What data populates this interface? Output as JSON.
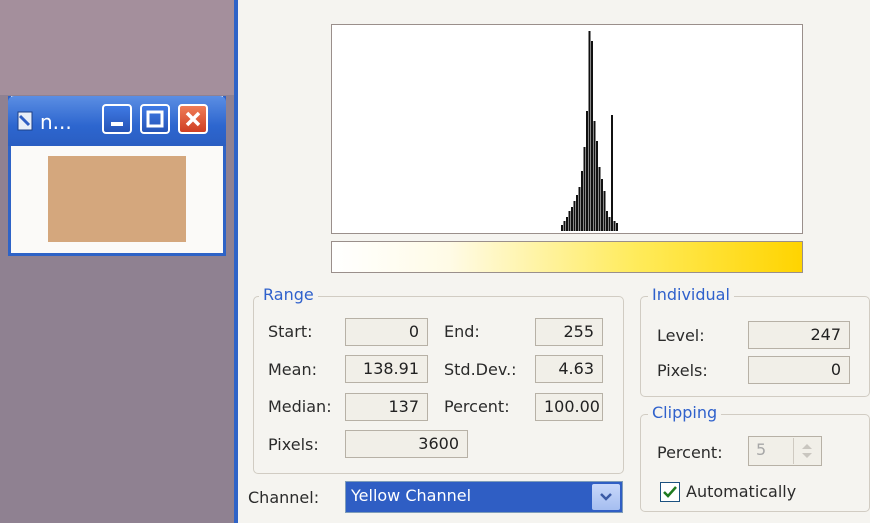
{
  "mini_window": {
    "title": "n...",
    "icons": [
      "document-icon",
      "minimize-icon",
      "maximize-icon",
      "close-icon"
    ],
    "preview_color": "#d4a77d"
  },
  "histogram": {
    "bars": [
      {
        "value": 10,
        "strength": 0.03
      },
      {
        "value": 11,
        "strength": 0.05
      },
      {
        "value": 12,
        "strength": 0.07
      },
      {
        "value": 13,
        "strength": 0.1
      },
      {
        "value": 14,
        "strength": 0.12
      },
      {
        "value": 15,
        "strength": 0.15
      },
      {
        "value": 16,
        "strength": 0.18
      },
      {
        "value": 17,
        "strength": 0.22
      },
      {
        "value": 18,
        "strength": 0.3
      },
      {
        "value": 19,
        "strength": 0.42
      },
      {
        "value": 20,
        "strength": 0.6
      },
      {
        "value": 21,
        "strength": 1.0
      },
      {
        "value": 22,
        "strength": 0.95
      },
      {
        "value": 23,
        "strength": 0.55
      },
      {
        "value": 24,
        "strength": 0.45
      },
      {
        "value": 25,
        "strength": 0.32
      },
      {
        "value": 26,
        "strength": 0.26
      },
      {
        "value": 27,
        "strength": 0.2
      },
      {
        "value": 28,
        "strength": 0.1
      },
      {
        "value": 29,
        "strength": 0.07
      },
      {
        "value": 30,
        "strength": 0.58
      },
      {
        "value": 31,
        "strength": 0.05
      },
      {
        "value": 32,
        "strength": 0.04
      }
    ],
    "gradient_colors": [
      "#ffffff",
      "#ffd400"
    ]
  },
  "range": {
    "title": "Range",
    "start_label": "Start:",
    "start": "0",
    "end_label": "End:",
    "end": "255",
    "mean_label": "Mean:",
    "mean": "138.91",
    "stddev_label": "Std.Dev.:",
    "stddev": "4.63",
    "median_label": "Median:",
    "median": "137",
    "percent_label": "Percent:",
    "percent": "100.00",
    "pixels_label": "Pixels:",
    "pixels": "3600"
  },
  "individual": {
    "title": "Individual",
    "level_label": "Level:",
    "level": "247",
    "pixels_label": "Pixels:",
    "pixels": "0"
  },
  "clipping": {
    "title": "Clipping",
    "percent_label": "Percent:",
    "percent": "5",
    "auto_label": "Automatically",
    "auto_checked": true
  },
  "channel": {
    "label": "Channel:",
    "value": "Yellow Channel"
  }
}
